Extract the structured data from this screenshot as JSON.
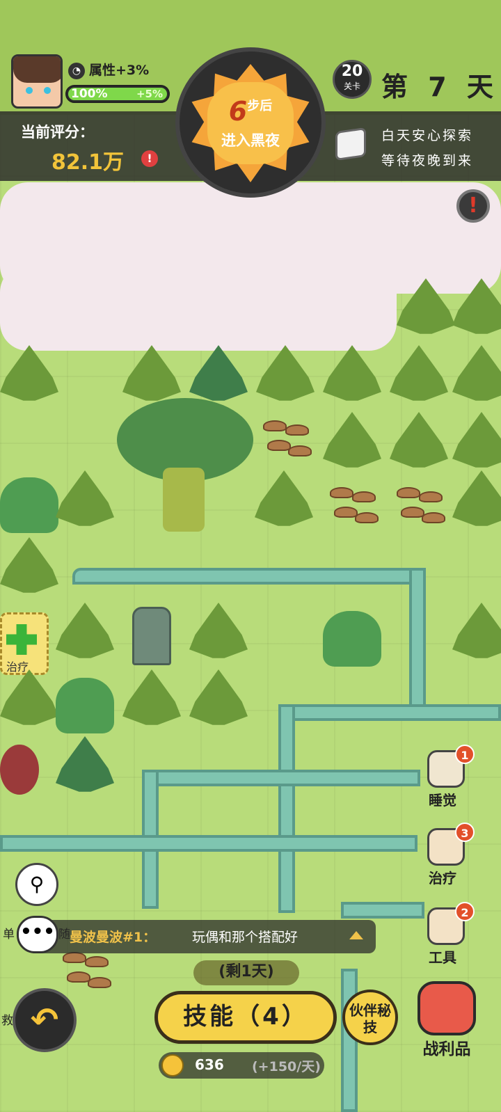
{
  "hud": {
    "attribute_bonus": "属性+3%",
    "hp_percent": "100%",
    "hp_bonus": "+5%",
    "hp_fill": 1.0,
    "score_label": "当前评分：",
    "score_value": "82.1万"
  },
  "sun": {
    "steps": "6",
    "steps_suffix": "步后",
    "line2": "进入黑夜"
  },
  "level": {
    "number": "20",
    "label": "关卡"
  },
  "day_label": "第 7 天",
  "tip": {
    "line1": "白天安心探索",
    "line2": "等待夜晚到来"
  },
  "heal_tile_label": "治疗",
  "side_buttons": [
    {
      "label": "睡觉",
      "badge": "1"
    },
    {
      "label": "治疗",
      "badge": "3"
    },
    {
      "label": "工具",
      "badge": "2"
    }
  ],
  "chat": {
    "name": "曼波曼波#1：",
    "message": "玩偶和那个搭配好"
  },
  "remaining": "(剩1天)",
  "skill_button": "技能（4）",
  "partner_button": "伙伴秘技",
  "loot_label": "战利品",
  "coins": {
    "value": "636",
    "rate": "(+150/天)"
  },
  "edge_labels": {
    "left1": "单",
    "left2": "随",
    "left3": "救护"
  },
  "colors": {
    "accent": "#f5d24a",
    "hud_bg": "#2b2b2b",
    "grass": "#b8dc7a"
  }
}
